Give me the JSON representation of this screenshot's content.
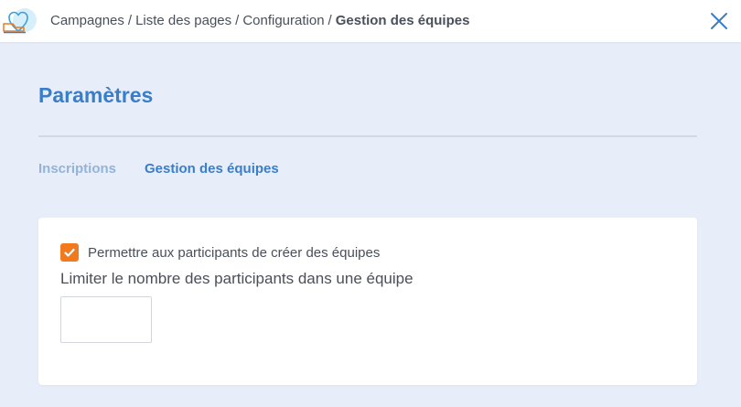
{
  "breadcrumb": {
    "items": [
      "Campagnes",
      "Liste des pages",
      "Configuration"
    ],
    "current": "Gestion des équipes",
    "separator": "/"
  },
  "header": {
    "title": "Paramètres"
  },
  "tabs": [
    {
      "label": "Inscriptions",
      "active": false
    },
    {
      "label": "Gestion des équipes",
      "active": true
    }
  ],
  "form": {
    "allow_teams_label": "Permettre aux participants de créer des équipes",
    "allow_teams_checked": true,
    "limit_label": "Limiter le nombre des participants dans une équipe",
    "limit_value": "",
    "limit_placeholder": ""
  },
  "icons": {
    "logo": "heart-hand-logo",
    "close": "close-icon",
    "check": "check-icon"
  },
  "colors": {
    "accent": "#3a7dc9",
    "accent_light": "#93b3d9",
    "checkbox": "#f07a1d",
    "background": "#e8eef9",
    "text": "#4a4f59"
  }
}
